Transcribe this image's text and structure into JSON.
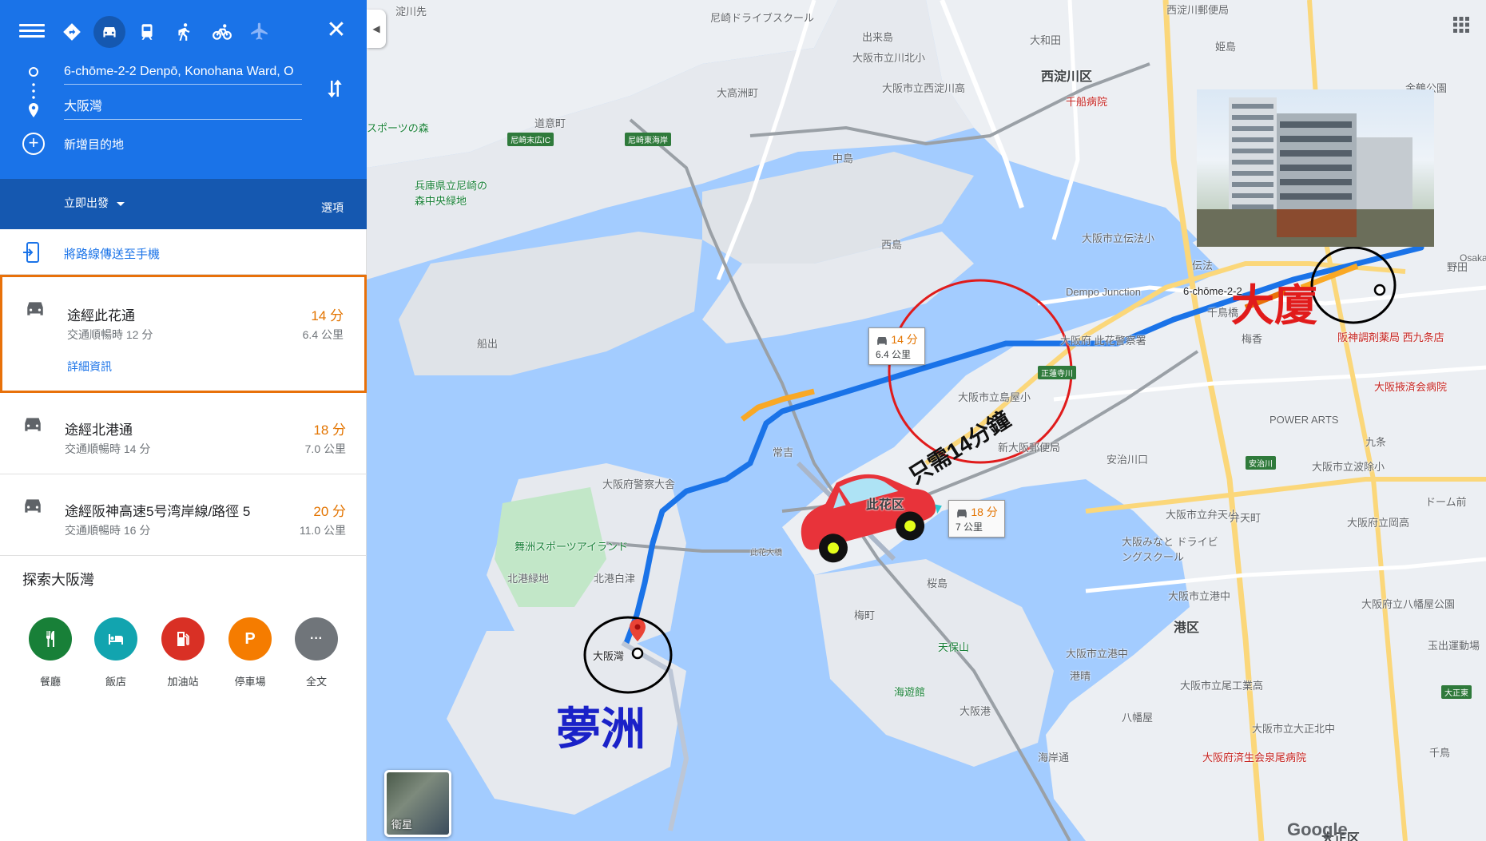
{
  "header": {
    "origin": "6-chōme-2-2 Denpō, Konohana Ward, O",
    "destination": "大阪灣",
    "add_destination": "新增目的地",
    "depart_now": "立即出發",
    "options": "選項"
  },
  "travel_modes": [
    "best-route-icon",
    "driving-icon",
    "transit-icon",
    "walking-icon",
    "cycling-icon",
    "flight-icon"
  ],
  "send_to_phone": "將路線傳送至手機",
  "routes": [
    {
      "name": "途經此花通",
      "time": "14 分",
      "sub": "交通順暢時 12 分",
      "distance": "6.4 公里",
      "detail": "詳細資訊"
    },
    {
      "name": "途經北港通",
      "time": "18 分",
      "sub": "交通順暢時 14 分",
      "distance": "7.0 公里"
    },
    {
      "name": "途經阪神高速5号湾岸線/路徑 5",
      "time": "20 分",
      "sub": "交通順暢時 16 分",
      "distance": "11.0 公里"
    }
  ],
  "explore": {
    "title": "探索大阪灣",
    "categories": [
      {
        "label": "餐廳",
        "color": "#188038",
        "icon": "restaurant-icon"
      },
      {
        "label": "飯店",
        "color": "#12a4af",
        "icon": "hotel-icon"
      },
      {
        "label": "加油站",
        "color": "#d93025",
        "icon": "gas-station-icon"
      },
      {
        "label": "停車場",
        "color": "#f57c00",
        "icon": "parking-icon",
        "glyph": "P"
      },
      {
        "label": "全文",
        "color": "#70757a",
        "icon": "more-icon",
        "glyph": "···"
      }
    ]
  },
  "map": {
    "bubble_main": {
      "time": "14 分",
      "dist": "6.4 公里"
    },
    "bubble_alt": {
      "time": "18 分",
      "dist": "7 公里"
    },
    "annotation_building": "大廈",
    "annotation_dream": "夢洲",
    "annotation_time": "只需14分鐘",
    "satellite": "衛星",
    "google": "Google",
    "labels": {
      "l1": "淀川先",
      "l2": "尼崎ドライブスクール",
      "l3": "出来島",
      "l4": "大和田",
      "l5": "西淀川郵便局",
      "l6": "姫島",
      "l7": "大阪市立川北小",
      "l8": "西淀川区",
      "l9": "大高洲町",
      "l10": "大阪市立西淀川高",
      "l11": "千船病院",
      "l12": "金鶴公園",
      "l13": "道意町",
      "l14": "スポーツの森",
      "l15": "尼崎末広IC",
      "l16": "尼崎東海岸",
      "l17": "中島",
      "l18": "兵庫県立尼崎の森中央緑地",
      "l19": "西島",
      "l20": "大阪市立伝法小",
      "l21": "伝法",
      "l22": "野田",
      "l23": "Osaka",
      "l24": "Dempo Junction",
      "l25": "6-chōme-2-2",
      "l26": "千鳥橋",
      "l27": "梅香",
      "l28": "阪神調剤薬局 西九条店",
      "l29": "船出",
      "l30": "大阪府 此花警察署",
      "l31": "正蓮寺川",
      "l32": "大阪市立島屋小",
      "l33": "大阪掖済会病院",
      "l34": "常吉",
      "l35": "新大阪郵便局",
      "l36": "POWER ARTS",
      "l37": "九条",
      "l38": "大阪府警察大舎",
      "l39": "安治川口",
      "l40": "安治川",
      "l41": "大阪市立波除小",
      "l42": "此花区",
      "l43": "ドーム前",
      "l44": "舞洲スポーツアイランド",
      "l45": "此花大橋",
      "l46": "大阪市立弁天小",
      "l47": "弁天町",
      "l48": "大阪府立岡高",
      "l49": "北港緑地",
      "l50": "北港白津",
      "l51": "大阪みなと ドライビングスクール",
      "l52": "桜島",
      "l53": "梅町",
      "l54": "大阪市立港中",
      "l55": "大阪府立八幡屋公園",
      "l56": "大阪灣",
      "l57": "天保山",
      "l58": "港区",
      "l59": "大阪市立港中",
      "l60": "海遊館",
      "l61": "港晴",
      "l62": "玉出運動場",
      "l63": "大阪港",
      "l64": "大阪市立尾工業高",
      "l65": "大正東",
      "l66": "八幡屋",
      "l67": "大阪市立大正北中",
      "l68": "海岸通",
      "l69": "大阪府済生会泉尾病院",
      "l70": "千鳥",
      "l71": "大正区",
      "l72": "西淀川郵便局"
    }
  }
}
